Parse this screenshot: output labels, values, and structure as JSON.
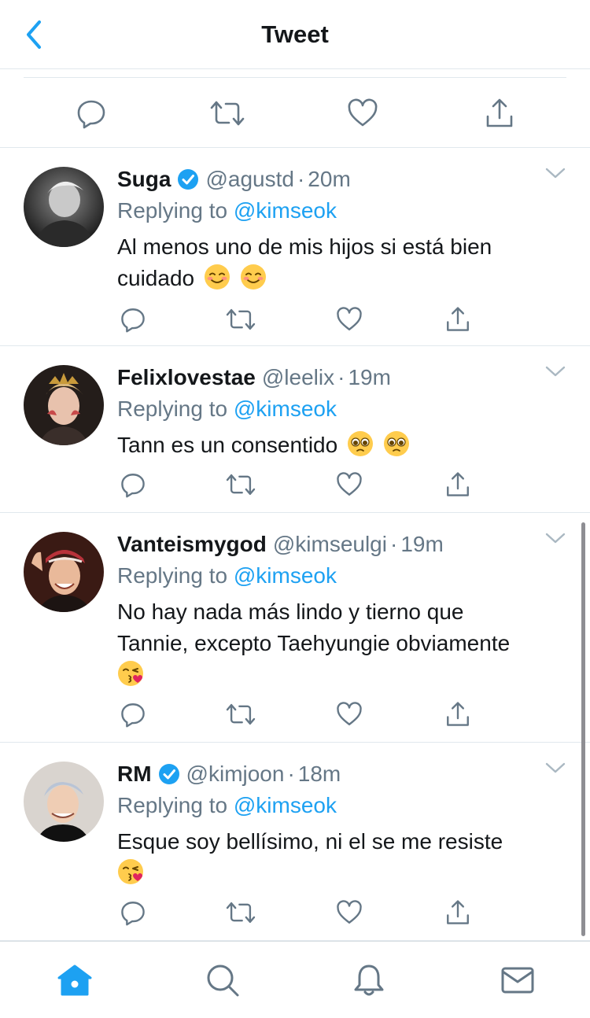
{
  "header": {
    "title": "Tweet"
  },
  "replies": [
    {
      "name": "Suga",
      "verified": true,
      "handle": "@agustd",
      "time": "20m",
      "replying_prefix": "Replying to",
      "replying_to": "@kimseok",
      "text": "Al menos uno de mis hijos si está bien cuidado",
      "emojis": [
        "smiling-face-emoji",
        "smiling-face-emoji"
      ]
    },
    {
      "name": "Felixlovestae",
      "verified": false,
      "handle": "@leelix",
      "time": "19m",
      "replying_prefix": "Replying to",
      "replying_to": "@kimseok",
      "text": "Tann es un consentido",
      "emojis": [
        "pleading-face-emoji",
        "pleading-face-emoji"
      ]
    },
    {
      "name": "Vanteismygod",
      "verified": false,
      "handle": "@kimseulgi",
      "time": "19m",
      "replying_prefix": "Replying to",
      "replying_to": "@kimseok",
      "text_line1": "No hay nada más lindo y tierno que",
      "text_line2": "Tannie, excepto Taehyungie obviamente",
      "emojis": [
        "kissing-face-emoji"
      ]
    },
    {
      "name": "RM",
      "verified": true,
      "handle": "@kimjoon",
      "time": "18m",
      "replying_prefix": "Replying to",
      "replying_to": "@kimseok",
      "text": "Esque soy bellísimo, ni el se me resiste",
      "emojis": [
        "kissing-face-emoji"
      ]
    }
  ],
  "icons": {
    "accent": "#1da1f2",
    "action_gray": "#657786",
    "tabs": [
      "home-icon",
      "search-icon",
      "bell-icon",
      "mail-icon"
    ]
  },
  "active_tab": "home"
}
